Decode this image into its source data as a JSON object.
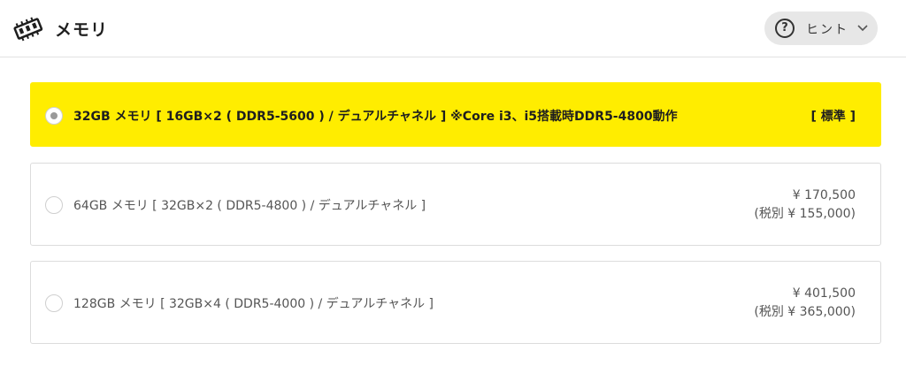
{
  "header": {
    "title": "メモリ",
    "icon": "memory-chip-icon"
  },
  "hint_button": {
    "icon": "question-circle-icon",
    "icon_glyph": "?",
    "label": "ヒント",
    "chevron_icon": "chevron-down-icon"
  },
  "options": [
    {
      "label": "32GB メモリ [ 16GB×2 ( DDR5-5600 ) / デュアルチャネル ] ※Core i3、i5搭載時DDR5-4800動作",
      "badge": "[ 標準 ]",
      "selected": true
    },
    {
      "label": "64GB メモリ [ 32GB×2 ( DDR5-4800 ) / デュアルチャネル ]",
      "price": "¥ 170,500",
      "price_ex_tax": "(税別 ¥ 155,000)",
      "selected": false
    },
    {
      "label": "128GB メモリ [ 32GB×4 ( DDR5-4000 ) / デュアルチャネル ]",
      "price": "¥ 401,500",
      "price_ex_tax": "(税別 ¥ 365,000)",
      "selected": false
    }
  ],
  "colors": {
    "selected_bg": "#ffed00",
    "hint_bg": "#e7e7e7",
    "border": "#dcdcdc"
  }
}
